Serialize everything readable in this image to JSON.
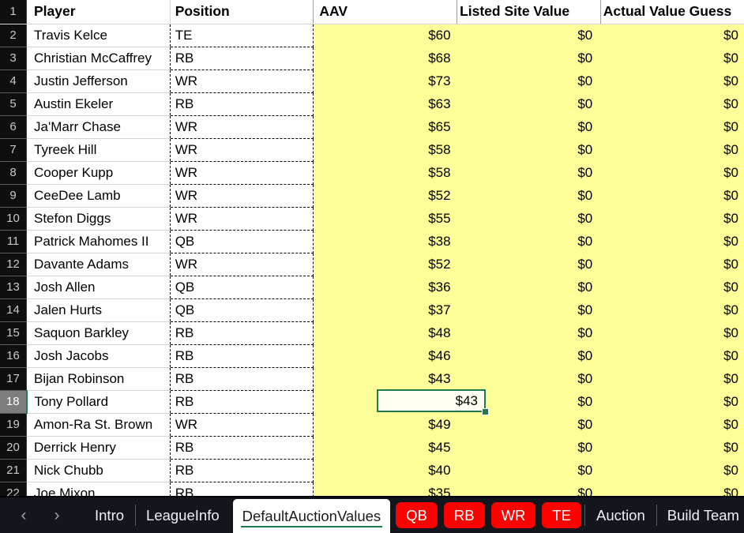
{
  "app": {
    "type": "spreadsheet"
  },
  "colors": {
    "highlight_fill": "#ffff99",
    "selection_border": "#1f7a4d",
    "tab_accent_red": "#ff0000",
    "rowheader_bg": "#0f0f0f",
    "tabbar_bg": "#13161d"
  },
  "sheet": {
    "columns": [
      {
        "key": "player",
        "header": "Player"
      },
      {
        "key": "position",
        "header": "Position"
      },
      {
        "key": "aav",
        "header": "AAV"
      },
      {
        "key": "listed_site_value",
        "header": "Listed Site Value"
      },
      {
        "key": "actual_value_guess",
        "header": "Actual Value Guess"
      }
    ],
    "header_row_number": "1",
    "selected_cell": {
      "row": "18",
      "column": "AAV",
      "value": "$43"
    },
    "rows": [
      {
        "n": "2",
        "player": "Travis Kelce",
        "position": "TE",
        "aav": "$60",
        "listed_site_value": "$0",
        "actual_value_guess": "$0"
      },
      {
        "n": "3",
        "player": "Christian McCaffrey",
        "position": "RB",
        "aav": "$68",
        "listed_site_value": "$0",
        "actual_value_guess": "$0"
      },
      {
        "n": "4",
        "player": "Justin Jefferson",
        "position": "WR",
        "aav": "$73",
        "listed_site_value": "$0",
        "actual_value_guess": "$0"
      },
      {
        "n": "5",
        "player": "Austin Ekeler",
        "position": "RB",
        "aav": "$63",
        "listed_site_value": "$0",
        "actual_value_guess": "$0"
      },
      {
        "n": "6",
        "player": "Ja'Marr Chase",
        "position": "WR",
        "aav": "$65",
        "listed_site_value": "$0",
        "actual_value_guess": "$0"
      },
      {
        "n": "7",
        "player": "Tyreek Hill",
        "position": "WR",
        "aav": "$58",
        "listed_site_value": "$0",
        "actual_value_guess": "$0"
      },
      {
        "n": "8",
        "player": "Cooper Kupp",
        "position": "WR",
        "aav": "$58",
        "listed_site_value": "$0",
        "actual_value_guess": "$0"
      },
      {
        "n": "9",
        "player": "CeeDee Lamb",
        "position": "WR",
        "aav": "$52",
        "listed_site_value": "$0",
        "actual_value_guess": "$0"
      },
      {
        "n": "10",
        "player": "Stefon Diggs",
        "position": "WR",
        "aav": "$55",
        "listed_site_value": "$0",
        "actual_value_guess": "$0"
      },
      {
        "n": "11",
        "player": "Patrick Mahomes II",
        "position": "QB",
        "aav": "$38",
        "listed_site_value": "$0",
        "actual_value_guess": "$0"
      },
      {
        "n": "12",
        "player": "Davante Adams",
        "position": "WR",
        "aav": "$52",
        "listed_site_value": "$0",
        "actual_value_guess": "$0"
      },
      {
        "n": "13",
        "player": "Josh Allen",
        "position": "QB",
        "aav": "$36",
        "listed_site_value": "$0",
        "actual_value_guess": "$0"
      },
      {
        "n": "14",
        "player": "Jalen Hurts",
        "position": "QB",
        "aav": "$37",
        "listed_site_value": "$0",
        "actual_value_guess": "$0"
      },
      {
        "n": "15",
        "player": "Saquon Barkley",
        "position": "RB",
        "aav": "$48",
        "listed_site_value": "$0",
        "actual_value_guess": "$0"
      },
      {
        "n": "16",
        "player": "Josh Jacobs",
        "position": "RB",
        "aav": "$46",
        "listed_site_value": "$0",
        "actual_value_guess": "$0"
      },
      {
        "n": "17",
        "player": "Bijan Robinson",
        "position": "RB",
        "aav": "$43",
        "listed_site_value": "$0",
        "actual_value_guess": "$0"
      },
      {
        "n": "18",
        "player": "Tony Pollard",
        "position": "RB",
        "aav": "$43",
        "listed_site_value": "$0",
        "actual_value_guess": "$0"
      },
      {
        "n": "19",
        "player": "Amon-Ra St. Brown",
        "position": "WR",
        "aav": "$49",
        "listed_site_value": "$0",
        "actual_value_guess": "$0"
      },
      {
        "n": "20",
        "player": "Derrick Henry",
        "position": "RB",
        "aav": "$45",
        "listed_site_value": "$0",
        "actual_value_guess": "$0"
      },
      {
        "n": "21",
        "player": "Nick Chubb",
        "position": "RB",
        "aav": "$40",
        "listed_site_value": "$0",
        "actual_value_guess": "$0"
      },
      {
        "n": "22",
        "player": "Joe Mixon",
        "position": "RB",
        "aav": "$35",
        "listed_site_value": "$0",
        "actual_value_guess": "$0"
      }
    ]
  },
  "tabbar": {
    "nav": {
      "prev": "‹",
      "next": "›"
    },
    "tabs": [
      {
        "label": "Intro",
        "active": false,
        "colored": false
      },
      {
        "label": "LeagueInfo",
        "active": false,
        "colored": false
      },
      {
        "label": "DefaultAuctionValues",
        "active": true,
        "colored": false
      },
      {
        "label": "QB",
        "active": false,
        "colored": true
      },
      {
        "label": "RB",
        "active": false,
        "colored": true
      },
      {
        "label": "WR",
        "active": false,
        "colored": true
      },
      {
        "label": "TE",
        "active": false,
        "colored": true
      },
      {
        "label": "Auction",
        "active": false,
        "colored": false
      },
      {
        "label": "Build Team",
        "active": false,
        "colored": false
      }
    ]
  }
}
